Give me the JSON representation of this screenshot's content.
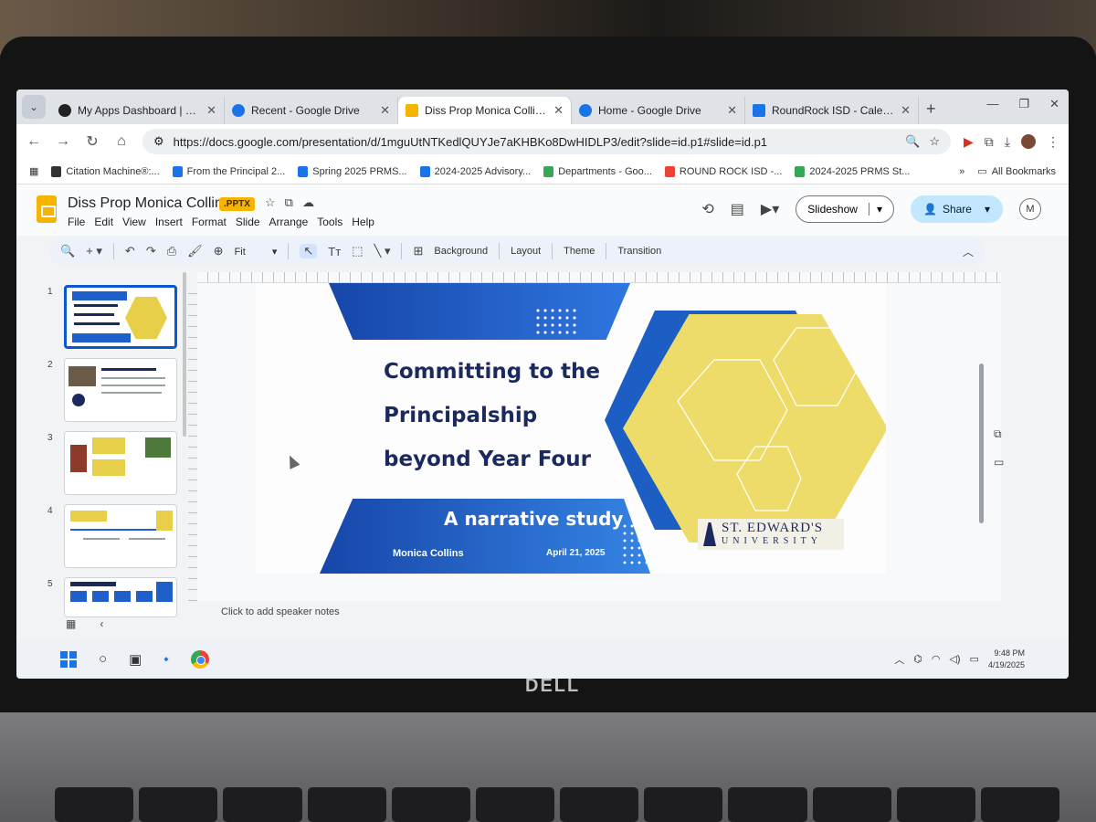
{
  "browser": {
    "tabs": [
      {
        "title": "My Apps Dashboard | St. Edwa",
        "color": "#222222"
      },
      {
        "title": "Recent - Google Drive",
        "color": "#1a73e8"
      },
      {
        "title": "Diss Prop Monica Collins.pptx",
        "color": "#f4b400",
        "active": true
      },
      {
        "title": "Home - Google Drive",
        "color": "#1a73e8"
      },
      {
        "title": "RoundRock ISD - Calendar -",
        "color": "#1a73e8"
      }
    ],
    "url": "https://docs.google.com/presentation/d/1mguUtNTKedlQUYJe7aKHBKo8DwHIDLP3/edit?slide=id.p1#slide=id.p1",
    "bookmarks": [
      {
        "label": "Citation Machine®:...",
        "color": "#333333"
      },
      {
        "label": "From the Principal 2...",
        "color": "#1a73e8"
      },
      {
        "label": "Spring 2025 PRMS...",
        "color": "#1a73e8"
      },
      {
        "label": "2024-2025 Advisory...",
        "color": "#1a73e8"
      },
      {
        "label": "Departments - Goo...",
        "color": "#34a853"
      },
      {
        "label": "ROUND ROCK ISD -...",
        "color": "#ea4335"
      },
      {
        "label": "2024-2025 PRMS St...",
        "color": "#34a853"
      }
    ],
    "all_bookmarks": "All Bookmarks"
  },
  "doc": {
    "title": "Diss Prop Monica Collins",
    "badge": ".PPTX",
    "menu": [
      "File",
      "Edit",
      "View",
      "Insert",
      "Format",
      "Slide",
      "Arrange",
      "Tools",
      "Help"
    ],
    "slideshow": "Slideshow",
    "share": "Share",
    "avatar": "M"
  },
  "toolbar": {
    "zoom": "Fit",
    "background": "Background",
    "layout": "Layout",
    "theme": "Theme",
    "transition": "Transition"
  },
  "filmstrip": {
    "numbers": [
      "1",
      "2",
      "3",
      "4",
      "5"
    ]
  },
  "slide": {
    "title_lines": [
      "Committing to the",
      "Principalship",
      "beyond Year Four"
    ],
    "subtitle": "A narrative study",
    "author": "Monica Collins",
    "date": "April 21, 2025",
    "logo_main": "ST. EDWARD'S",
    "logo_sub": "UNIVERSITY",
    "colors": {
      "navy": "#1b2a5e",
      "blue": "#1f5fc9",
      "yellow": "#eedc6a"
    }
  },
  "notes": "Click to add speaker notes",
  "taskbar": {
    "time": "9:48 PM",
    "date": "4/19/2025"
  },
  "laptop": {
    "brand": "DELL"
  }
}
